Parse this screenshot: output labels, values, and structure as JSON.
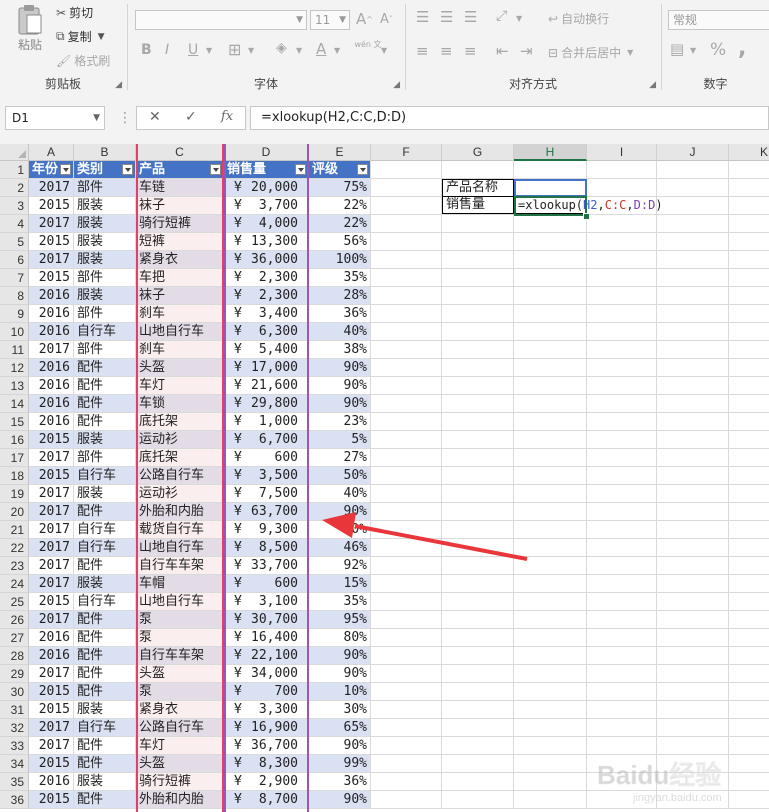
{
  "ribbon": {
    "clipboard": {
      "title": "剪贴板",
      "paste": "粘贴",
      "cut": "剪切",
      "copy": "复制",
      "format_painter": "格式刷"
    },
    "font": {
      "title": "字体",
      "font_name": "",
      "font_size": "11",
      "bold": "B",
      "italic": "I",
      "underline": "U",
      "wen_glyph": "wén 文"
    },
    "alignment": {
      "title": "对齐方式",
      "wrap_text": "自动换行",
      "merge_center": "合并后居中"
    },
    "number": {
      "title": "数字",
      "format": "常规",
      "percent": "%",
      "comma": ","
    }
  },
  "formula_bar": {
    "name_box": "D1",
    "fx": "fx",
    "formula": "=xlookup(H2,C:C,D:D)"
  },
  "columns": [
    "A",
    "B",
    "C",
    "D",
    "E",
    "F",
    "G",
    "H",
    "I",
    "J",
    "K"
  ],
  "active_column": "H",
  "table": {
    "headers": [
      "年份",
      "类别",
      "产品",
      "销售量",
      "评级"
    ],
    "currency_symbol": "¥",
    "rows": [
      [
        "2",
        "2017",
        "部件",
        "车链",
        "20,000",
        "75%"
      ],
      [
        "3",
        "2015",
        "服装",
        "袜子",
        "3,700",
        "22%"
      ],
      [
        "4",
        "2017",
        "服装",
        "骑行短裤",
        "4,000",
        "22%"
      ],
      [
        "5",
        "2015",
        "服装",
        "短裤",
        "13,300",
        "56%"
      ],
      [
        "6",
        "2017",
        "服装",
        "紧身衣",
        "36,000",
        "100%"
      ],
      [
        "7",
        "2015",
        "部件",
        "车把",
        "2,300",
        "35%"
      ],
      [
        "8",
        "2016",
        "服装",
        "袜子",
        "2,300",
        "28%"
      ],
      [
        "9",
        "2016",
        "部件",
        "刹车",
        "3,400",
        "36%"
      ],
      [
        "10",
        "2016",
        "自行车",
        "山地自行车",
        "6,300",
        "40%"
      ],
      [
        "11",
        "2017",
        "部件",
        "刹车",
        "5,400",
        "38%"
      ],
      [
        "12",
        "2016",
        "配件",
        "头盔",
        "17,000",
        "90%"
      ],
      [
        "13",
        "2016",
        "配件",
        "车灯",
        "21,600",
        "90%"
      ],
      [
        "14",
        "2016",
        "配件",
        "车锁",
        "29,800",
        "90%"
      ],
      [
        "15",
        "2016",
        "配件",
        "底托架",
        "1,000",
        "23%"
      ],
      [
        "16",
        "2015",
        "服装",
        "运动衫",
        "6,700",
        "5%"
      ],
      [
        "17",
        "2017",
        "部件",
        "底托架",
        "600",
        "27%"
      ],
      [
        "18",
        "2015",
        "自行车",
        "公路自行车",
        "3,500",
        "50%"
      ],
      [
        "19",
        "2017",
        "服装",
        "运动衫",
        "7,500",
        "40%"
      ],
      [
        "20",
        "2017",
        "配件",
        "外胎和内胎",
        "63,700",
        "90%"
      ],
      [
        "21",
        "2017",
        "自行车",
        "载货自行车",
        "9,300",
        "60%"
      ],
      [
        "22",
        "2017",
        "自行车",
        "山地自行车",
        "8,500",
        "46%"
      ],
      [
        "23",
        "2017",
        "配件",
        "自行车车架",
        "33,700",
        "92%"
      ],
      [
        "24",
        "2017",
        "服装",
        "车帽",
        "600",
        "15%"
      ],
      [
        "25",
        "2015",
        "自行车",
        "山地自行车",
        "3,100",
        "35%"
      ],
      [
        "26",
        "2017",
        "配件",
        "泵",
        "30,700",
        "95%"
      ],
      [
        "27",
        "2016",
        "配件",
        "泵",
        "16,400",
        "80%"
      ],
      [
        "28",
        "2016",
        "配件",
        "自行车车架",
        "22,100",
        "90%"
      ],
      [
        "29",
        "2017",
        "配件",
        "头盔",
        "34,000",
        "90%"
      ],
      [
        "30",
        "2015",
        "配件",
        "泵",
        "700",
        "10%"
      ],
      [
        "31",
        "2015",
        "服装",
        "紧身衣",
        "3,300",
        "30%"
      ],
      [
        "32",
        "2017",
        "自行车",
        "公路自行车",
        "16,900",
        "65%"
      ],
      [
        "33",
        "2017",
        "配件",
        "车灯",
        "36,700",
        "90%"
      ],
      [
        "34",
        "2015",
        "配件",
        "头盔",
        "8,300",
        "99%"
      ],
      [
        "35",
        "2016",
        "服装",
        "骑行短裤",
        "2,900",
        "36%"
      ],
      [
        "36",
        "2015",
        "配件",
        "外胎和内胎",
        "8,700",
        "90%"
      ]
    ]
  },
  "lookup": {
    "label_product": "产品名称",
    "label_sales": "销售量",
    "product_value": "",
    "formula_tokens": [
      {
        "text": "=xlookup(",
        "kind": "fn"
      },
      {
        "text": "H2",
        "kind": "ref1"
      },
      {
        "text": ",",
        "kind": "fn"
      },
      {
        "text": "C:C",
        "kind": "ref2"
      },
      {
        "text": ",",
        "kind": "fn"
      },
      {
        "text": "D:D",
        "kind": "ref3"
      },
      {
        "text": ")",
        "kind": "fn"
      }
    ]
  },
  "colors": {
    "accent": "#217346",
    "header_blue": "#4472c4",
    "band_blue": "#d9e1f2",
    "arrow_red": "#e8363b"
  },
  "watermark": {
    "text": "Baidu经验",
    "sub": "jingyan.baidu.com"
  }
}
